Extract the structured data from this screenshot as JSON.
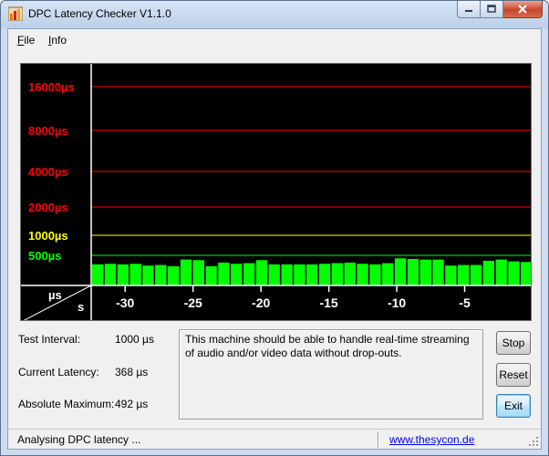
{
  "window": {
    "title": "DPC Latency Checker V1.1.0"
  },
  "menu": [
    {
      "label": "File",
      "key": "F",
      "rest": "ile"
    },
    {
      "label": "Info",
      "key": "I",
      "rest": "nfo"
    }
  ],
  "chart_data": {
    "type": "bar",
    "y_unit": "µs",
    "x_unit": "s",
    "y_axis_labels": [
      {
        "text": "16000µs",
        "value": 16000,
        "color": "#ff0000"
      },
      {
        "text": "8000µs",
        "value": 8000,
        "color": "#ff0000"
      },
      {
        "text": "4000µs",
        "value": 4000,
        "color": "#ff0000"
      },
      {
        "text": "2000µs",
        "value": 2000,
        "color": "#ff0000"
      },
      {
        "text": "1000µs",
        "value": 1000,
        "color": "#ffff00"
      },
      {
        "text": "500µs",
        "value": 500,
        "color": "#00ff00"
      }
    ],
    "x_ticks": [
      "-30",
      "-25",
      "-20",
      "-15",
      "-10",
      "-5"
    ],
    "x_tick_values": [
      -30,
      -25,
      -20,
      -15,
      -10,
      -5
    ],
    "x_range": [
      -32.5,
      0
    ],
    "bar_color": "#00ff00",
    "values": [
      350,
      360,
      350,
      360,
      330,
      340,
      320,
      430,
      420,
      320,
      380,
      360,
      370,
      420,
      350,
      350,
      350,
      350,
      360,
      370,
      380,
      360,
      350,
      370,
      450,
      440,
      430,
      430,
      330,
      340,
      340,
      410,
      430,
      400,
      390
    ]
  },
  "stats": {
    "test_interval_label": "Test Interval:",
    "test_interval_value": "1000 µs",
    "current_latency_label": "Current Latency:",
    "current_latency_value": "368 µs",
    "absolute_maximum_label": "Absolute Maximum:",
    "absolute_maximum_value": "492 µs"
  },
  "message": "This machine should be able to handle real-time streaming of audio and/or video data without drop-outs.",
  "buttons": {
    "stop": "Stop",
    "reset": "Reset",
    "exit": "Exit"
  },
  "status": {
    "text": "Analysing DPC latency ...",
    "link": "www.thesycon.de"
  }
}
